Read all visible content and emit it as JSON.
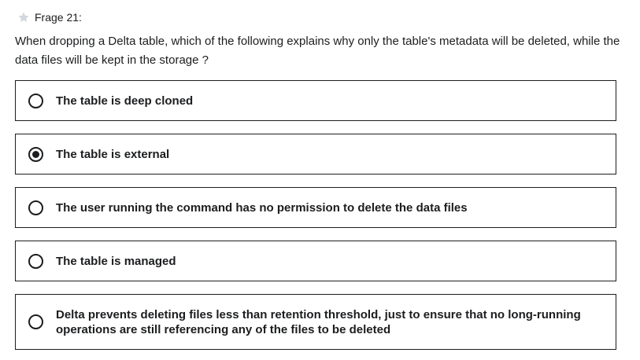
{
  "question": {
    "star_icon": "star-icon",
    "label": "Frage 21:",
    "text": "When dropping a Delta table, which of the following explains why only the table's metadata will be deleted, while the data files will be kept in the storage ?"
  },
  "options": [
    {
      "label": "The table is deep cloned",
      "selected": false
    },
    {
      "label": "The table is external",
      "selected": true
    },
    {
      "label": "The user running the command has no permission to delete the data files",
      "selected": false
    },
    {
      "label": "The table is managed",
      "selected": false
    },
    {
      "label": "Delta prevents deleting files less than retention threshold, just to ensure that no long-running operations are still referencing any of the files to be deleted",
      "selected": false
    }
  ],
  "colors": {
    "text": "#1c1d1f",
    "star": "#d1d7dc",
    "border": "#1c1d1f"
  }
}
